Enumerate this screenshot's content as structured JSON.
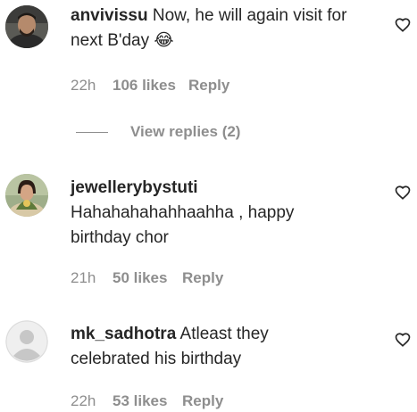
{
  "comments": [
    {
      "username": "anvivissu",
      "text_line1": "Now, he will again visit for",
      "text_line2": "next B'day",
      "emoji": "😂",
      "time": "22h",
      "likes": "106 likes",
      "reply": "Reply"
    },
    {
      "username": "jewellerybystuti",
      "text_line1": "Hahahahahahhaahha , happy",
      "text_line2": "birthday chor",
      "time": "21h",
      "likes": "50 likes",
      "reply": "Reply"
    },
    {
      "username": "mk_sadhotra",
      "text_line1": "Atleast they",
      "text_line2": "celebrated his birthday",
      "time": "22h",
      "likes": "53 likes",
      "reply": "Reply"
    }
  ],
  "view_replies": "View replies (2)",
  "icons": {
    "like": "heart-icon",
    "default_avatar": "default-avatar-icon"
  },
  "colors": {
    "text": "#262626",
    "secondary": "#8e8e8e",
    "default_avatar_bg": "#dbdbdb"
  }
}
